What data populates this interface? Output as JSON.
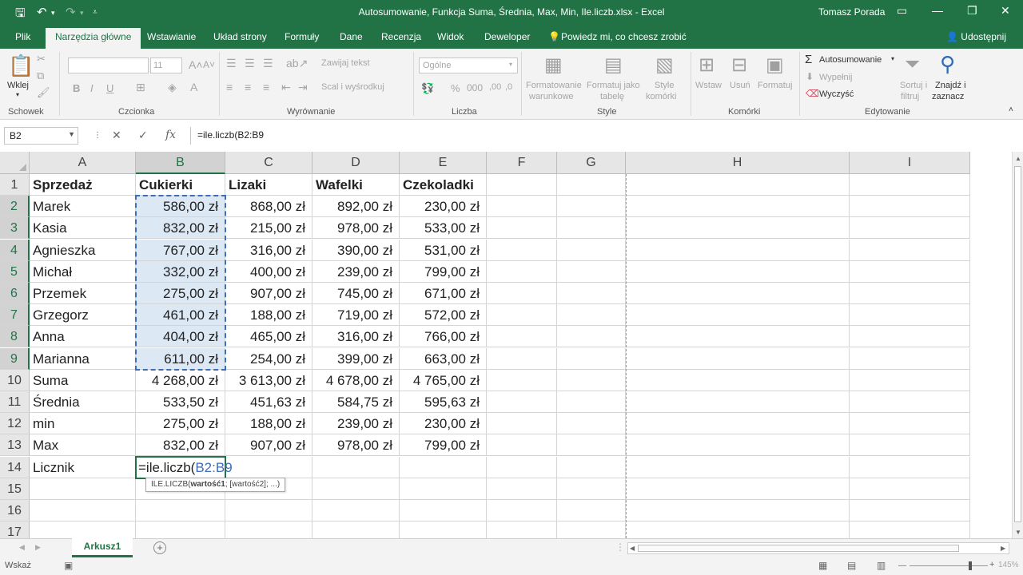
{
  "titlebar": {
    "document_title": "Autosumowanie, Funkcja Suma, Średnia, Max, Min, Ile.liczb.xlsx  -  Excel",
    "user_name": "Tomasz Porada"
  },
  "ribbon_tabs": [
    "Plik",
    "Narzędzia główne",
    "Wstawianie",
    "Układ strony",
    "Formuły",
    "Dane",
    "Recenzja",
    "Widok",
    "Deweloper",
    "Powiedz mi, co chcesz zrobić"
  ],
  "share_label": "Udostępnij",
  "ribbon": {
    "paste_label": "Wklej",
    "font_size": "11",
    "wrap_text": "Zawijaj tekst",
    "merge_center": "Scal i wyśrodkuj",
    "number_format": "Ogólne",
    "conditional_formatting": [
      "Formatowanie",
      "warunkowe"
    ],
    "format_as_table": [
      "Formatuj jako",
      "tabelę"
    ],
    "cell_styles": [
      "Style",
      "komórki"
    ],
    "insert": "Wstaw",
    "delete": "Usuń",
    "format": "Formatuj",
    "autosum": "Autosumowanie",
    "fill": "Wypełnij",
    "clear": "Wyczyść",
    "sort_filter": [
      "Sortuj i",
      "filtruj"
    ],
    "find_select": [
      "Znajdź i",
      "zaznacz"
    ],
    "font_buttons": [
      "B",
      "I",
      "U"
    ],
    "groups": [
      "Schowek",
      "Czcionka",
      "Wyrównanie",
      "Liczba",
      "Style",
      "Komórki",
      "Edytowanie"
    ]
  },
  "formula_bar": {
    "name_box": "B2",
    "formula": "=ile.liczb(B2:B9"
  },
  "columns": [
    "A",
    "B",
    "C",
    "D",
    "E",
    "F",
    "G",
    "H",
    "I"
  ],
  "rows": [
    "1",
    "2",
    "3",
    "4",
    "5",
    "6",
    "7",
    "8",
    "9",
    "10",
    "11",
    "12",
    "13",
    "14",
    "15",
    "16",
    "17"
  ],
  "table": {
    "headers": [
      "Sprzedaż",
      "Cukierki",
      "Lizaki",
      "Wafelki",
      "Czekoladki"
    ],
    "rows": [
      [
        "Marek",
        "586,00 zł",
        "868,00 zł",
        "892,00 zł",
        "230,00 zł"
      ],
      [
        "Kasia",
        "832,00 zł",
        "215,00 zł",
        "978,00 zł",
        "533,00 zł"
      ],
      [
        "Agnieszka",
        "767,00 zł",
        "316,00 zł",
        "390,00 zł",
        "531,00 zł"
      ],
      [
        "Michał",
        "332,00 zł",
        "400,00 zł",
        "239,00 zł",
        "799,00 zł"
      ],
      [
        "Przemek",
        "275,00 zł",
        "907,00 zł",
        "745,00 zł",
        "671,00 zł"
      ],
      [
        "Grzegorz",
        "461,00 zł",
        "188,00 zł",
        "719,00 zł",
        "572,00 zł"
      ],
      [
        "Anna",
        "404,00 zł",
        "465,00 zł",
        "316,00 zł",
        "766,00 zł"
      ],
      [
        "Marianna",
        "611,00 zł",
        "254,00 zł",
        "399,00 zł",
        "663,00 zł"
      ],
      [
        "Suma",
        "4 268,00 zł",
        "3 613,00 zł",
        "4 678,00 zł",
        "4 765,00 zł"
      ],
      [
        "Średnia",
        "533,50 zł",
        "451,63 zł",
        "584,75 zł",
        "595,63 zł"
      ],
      [
        "min",
        "275,00 zł",
        "188,00 zł",
        "239,00 zł",
        "230,00 zł"
      ],
      [
        "Max",
        "832,00 zł",
        "907,00 zł",
        "978,00 zł",
        "799,00 zł"
      ]
    ],
    "licznik_label": "Licznik"
  },
  "editing_cell": {
    "prefix": "=ile.liczb(",
    "ref": "B2:B9"
  },
  "tooltip": {
    "fn": "ILE.LICZB(",
    "arg1": "wartość1",
    "rest": "; [wartość2]; ...)"
  },
  "sheet_tab": "Arkusz1",
  "status": "Wskaż",
  "zoom": "145%",
  "colors": {
    "excel_green": "#217346",
    "reference_blue": "#3e6eb8",
    "selection_fill": "#dde8f5"
  }
}
